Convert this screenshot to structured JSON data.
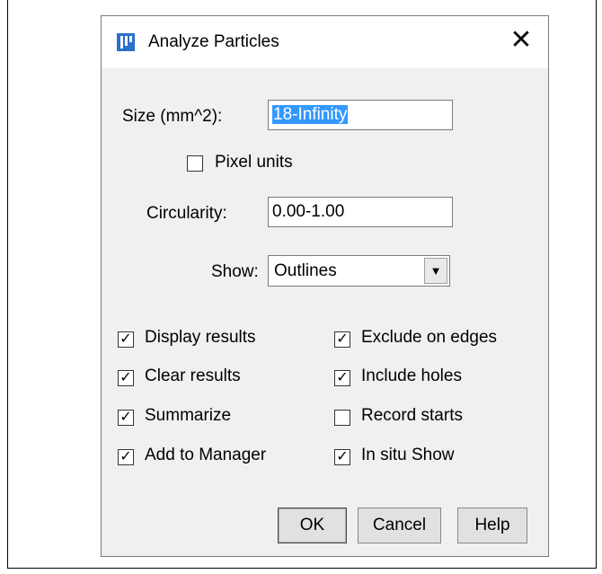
{
  "dialog": {
    "title": "Analyze Particles",
    "close_symbol": "✕",
    "icon": "imagej-icon"
  },
  "size": {
    "label": "Size (mm^2):",
    "value": "18-Infinity"
  },
  "pixel_units": {
    "label": "Pixel units",
    "checked": false
  },
  "circularity": {
    "label": "Circularity:",
    "value": "0.00-1.00"
  },
  "show": {
    "label": "Show:",
    "value": "Outlines"
  },
  "options": {
    "display_results": {
      "label": "Display results",
      "checked": true
    },
    "clear_results": {
      "label": "Clear results",
      "checked": true
    },
    "summarize": {
      "label": "Summarize",
      "checked": true
    },
    "add_to_manager": {
      "label": "Add to Manager",
      "checked": true
    },
    "exclude_on_edges": {
      "label": "Exclude on edges",
      "checked": true
    },
    "include_holes": {
      "label": "Include holes",
      "checked": true
    },
    "record_starts": {
      "label": "Record starts",
      "checked": false
    },
    "in_situ_show": {
      "label": "In situ Show",
      "checked": true
    }
  },
  "buttons": {
    "ok": "OK",
    "cancel": "Cancel",
    "help": "Help"
  }
}
